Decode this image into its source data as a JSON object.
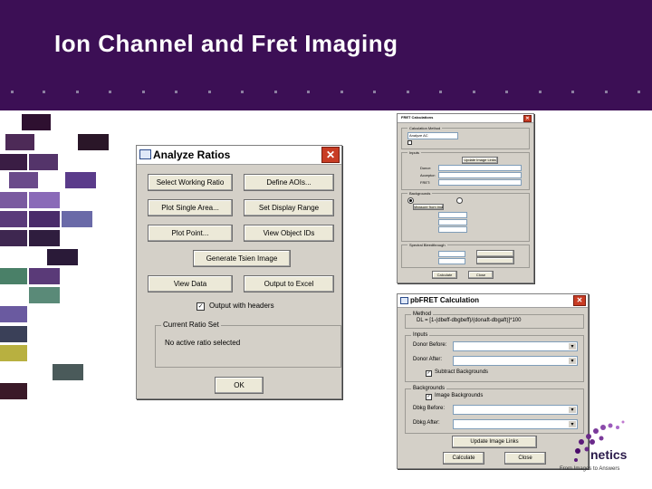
{
  "slide": {
    "title": "Ion Channel and Fret Imaging"
  },
  "colors": {
    "header_bg": "#3c0f55",
    "window_bg": "#d4d0c8",
    "close_red": "#c83c24"
  },
  "analyze_ratios": {
    "title": "Analyze Ratios",
    "buttons": {
      "select_working_ratio": "Select Working Ratio",
      "define_aois": "Define AOIs...",
      "plot_single_area": "Plot Single Area...",
      "set_display_range": "Set Display Range",
      "plot_point": "Plot Point...",
      "view_object_ids": "View Object IDs",
      "generate_tsien_image": "Generate Tsien Image",
      "view_data": "View Data",
      "output_to_excel": "Output to Excel",
      "ok": "OK"
    },
    "output_with_headers": "Output with headers",
    "current_ratio_set_label": "Current Ratio Set",
    "current_ratio_set_value": "No active ratio selected"
  },
  "fret_calculations": {
    "title": "FRET Calculations",
    "calc_method_label": "Calculation Method",
    "calc_method_value": "Analyze AC",
    "inputs_label": "Inputs",
    "backgrounds_label": "Backgrounds",
    "spectral_label": "Spectral Bleedthrough",
    "donor_label": "Donor:",
    "acceptor_label": "Acceptor:",
    "fret_label": "FRET:",
    "update_links": "Update Image Links",
    "measure_from_image": "Measure from image",
    "calculate": "Calculate",
    "close": "Close"
  },
  "pbfret": {
    "title": "pbFRET Calculation",
    "method_label": "Method",
    "formula": "DL = [1-(dbeff-dbgbeff)/(donaft-dbgaft)]*100",
    "inputs_label": "Inputs",
    "donor_before_label": "Donor Before:",
    "donor_after_label": "Donor After:",
    "subtract_backgrounds": "Subtract Backgrounds",
    "backgrounds_label": "Backgrounds",
    "image_backgrounds": "Image Backgrounds",
    "dbkg_before_label": "Dbkg Before:",
    "dbkg_after_label": "Dbkg After:",
    "update_image_links": "Update Image Links",
    "calculate": "Calculate",
    "close": "Close"
  },
  "logo": {
    "text": "netics",
    "tagline": "From Images to Answers"
  }
}
